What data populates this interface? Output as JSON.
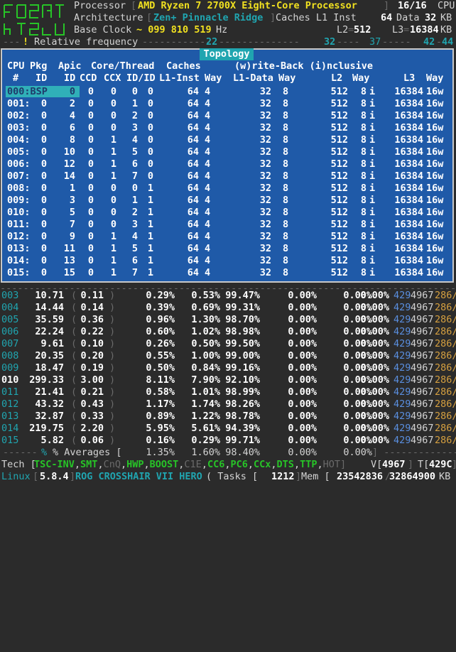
{
  "header": {
    "processor_label": "Processor",
    "processor_name": "AMD Ryzen 7 2700X Eight-Core Processor",
    "cpu_count": "16/16",
    "cpu_unit": "CPU",
    "architecture_label": "Architecture",
    "architecture_value": "Zen+ Pinnacle Ridge",
    "caches_label": "Caches L1 Inst",
    "l1_inst": "64",
    "data_label": "Data",
    "l1_data": "32",
    "kb": "KB",
    "base_clock_label": "Base Clock",
    "base_clock_value": "~ 099 810 519",
    "hz": "Hz",
    "l2_label": "L2",
    "l2_value": "512",
    "l3_label": "L3",
    "l3_value": "16384",
    "rel_freq_marker": "!",
    "rel_freq_label": "Relative frequency",
    "rel_freq_ticks": [
      "22",
      "32",
      "37",
      "42",
      "44"
    ]
  },
  "topology": {
    "title": "Topology",
    "header1": [
      "CPU",
      "Pkg",
      "Apic",
      "Core/Thread",
      "Caches",
      "(w)rite-Back (i)nclusive"
    ],
    "header2": [
      "#",
      "ID",
      "ID",
      "CCD",
      "CCX",
      "ID/ID",
      "L1-Inst",
      "Way",
      "L1-Data",
      "Way",
      "L2",
      "Way",
      "L3",
      "Way"
    ],
    "rows": [
      {
        "cpu": "000:BSP",
        "pkg": "",
        "apic": "0",
        "ccd": "0",
        "ccx": "0",
        "core": "0",
        "thread": "0",
        "l1i": "64",
        "l1iw": "4",
        "l1d": "32",
        "l1dw": "8",
        "l2": "512",
        "l2w": "8",
        "incl": "i",
        "l3": "16384",
        "l3w": "16w"
      },
      {
        "cpu": "001:",
        "pkg": "0",
        "apic": "2",
        "ccd": "0",
        "ccx": "0",
        "core": "1",
        "thread": "0",
        "l1i": "64",
        "l1iw": "4",
        "l1d": "32",
        "l1dw": "8",
        "l2": "512",
        "l2w": "8",
        "incl": "i",
        "l3": "16384",
        "l3w": "16w"
      },
      {
        "cpu": "002:",
        "pkg": "0",
        "apic": "4",
        "ccd": "0",
        "ccx": "0",
        "core": "2",
        "thread": "0",
        "l1i": "64",
        "l1iw": "4",
        "l1d": "32",
        "l1dw": "8",
        "l2": "512",
        "l2w": "8",
        "incl": "i",
        "l3": "16384",
        "l3w": "16w"
      },
      {
        "cpu": "003:",
        "pkg": "0",
        "apic": "6",
        "ccd": "0",
        "ccx": "0",
        "core": "3",
        "thread": "0",
        "l1i": "64",
        "l1iw": "4",
        "l1d": "32",
        "l1dw": "8",
        "l2": "512",
        "l2w": "8",
        "incl": "i",
        "l3": "16384",
        "l3w": "16w"
      },
      {
        "cpu": "004:",
        "pkg": "0",
        "apic": "8",
        "ccd": "0",
        "ccx": "1",
        "core": "4",
        "thread": "0",
        "l1i": "64",
        "l1iw": "4",
        "l1d": "32",
        "l1dw": "8",
        "l2": "512",
        "l2w": "8",
        "incl": "i",
        "l3": "16384",
        "l3w": "16w"
      },
      {
        "cpu": "005:",
        "pkg": "0",
        "apic": "10",
        "ccd": "0",
        "ccx": "1",
        "core": "5",
        "thread": "0",
        "l1i": "64",
        "l1iw": "4",
        "l1d": "32",
        "l1dw": "8",
        "l2": "512",
        "l2w": "8",
        "incl": "i",
        "l3": "16384",
        "l3w": "16w"
      },
      {
        "cpu": "006:",
        "pkg": "0",
        "apic": "12",
        "ccd": "0",
        "ccx": "1",
        "core": "6",
        "thread": "0",
        "l1i": "64",
        "l1iw": "4",
        "l1d": "32",
        "l1dw": "8",
        "l2": "512",
        "l2w": "8",
        "incl": "i",
        "l3": "16384",
        "l3w": "16w"
      },
      {
        "cpu": "007:",
        "pkg": "0",
        "apic": "14",
        "ccd": "0",
        "ccx": "1",
        "core": "7",
        "thread": "0",
        "l1i": "64",
        "l1iw": "4",
        "l1d": "32",
        "l1dw": "8",
        "l2": "512",
        "l2w": "8",
        "incl": "i",
        "l3": "16384",
        "l3w": "16w"
      },
      {
        "cpu": "008:",
        "pkg": "0",
        "apic": "1",
        "ccd": "0",
        "ccx": "0",
        "core": "0",
        "thread": "1",
        "l1i": "64",
        "l1iw": "4",
        "l1d": "32",
        "l1dw": "8",
        "l2": "512",
        "l2w": "8",
        "incl": "i",
        "l3": "16384",
        "l3w": "16w"
      },
      {
        "cpu": "009:",
        "pkg": "0",
        "apic": "3",
        "ccd": "0",
        "ccx": "0",
        "core": "1",
        "thread": "1",
        "l1i": "64",
        "l1iw": "4",
        "l1d": "32",
        "l1dw": "8",
        "l2": "512",
        "l2w": "8",
        "incl": "i",
        "l3": "16384",
        "l3w": "16w"
      },
      {
        "cpu": "010:",
        "pkg": "0",
        "apic": "5",
        "ccd": "0",
        "ccx": "0",
        "core": "2",
        "thread": "1",
        "l1i": "64",
        "l1iw": "4",
        "l1d": "32",
        "l1dw": "8",
        "l2": "512",
        "l2w": "8",
        "incl": "i",
        "l3": "16384",
        "l3w": "16w"
      },
      {
        "cpu": "011:",
        "pkg": "0",
        "apic": "7",
        "ccd": "0",
        "ccx": "0",
        "core": "3",
        "thread": "1",
        "l1i": "64",
        "l1iw": "4",
        "l1d": "32",
        "l1dw": "8",
        "l2": "512",
        "l2w": "8",
        "incl": "i",
        "l3": "16384",
        "l3w": "16w"
      },
      {
        "cpu": "012:",
        "pkg": "0",
        "apic": "9",
        "ccd": "0",
        "ccx": "1",
        "core": "4",
        "thread": "1",
        "l1i": "64",
        "l1iw": "4",
        "l1d": "32",
        "l1dw": "8",
        "l2": "512",
        "l2w": "8",
        "incl": "i",
        "l3": "16384",
        "l3w": "16w"
      },
      {
        "cpu": "013:",
        "pkg": "0",
        "apic": "11",
        "ccd": "0",
        "ccx": "1",
        "core": "5",
        "thread": "1",
        "l1i": "64",
        "l1iw": "4",
        "l1d": "32",
        "l1dw": "8",
        "l2": "512",
        "l2w": "8",
        "incl": "i",
        "l3": "16384",
        "l3w": "16w"
      },
      {
        "cpu": "014:",
        "pkg": "0",
        "apic": "13",
        "ccd": "0",
        "ccx": "1",
        "core": "6",
        "thread": "1",
        "l1i": "64",
        "l1iw": "4",
        "l1d": "32",
        "l1dw": "8",
        "l2": "512",
        "l2w": "8",
        "incl": "i",
        "l3": "16384",
        "l3w": "16w"
      },
      {
        "cpu": "015:",
        "pkg": "0",
        "apic": "15",
        "ccd": "0",
        "ccx": "1",
        "core": "7",
        "thread": "1",
        "l1i": "64",
        "l1iw": "4",
        "l1d": "32",
        "l1dw": "8",
        "l2": "512",
        "l2w": "8",
        "incl": "i",
        "l3": "16384",
        "l3w": "16w"
      }
    ]
  },
  "stats": {
    "rows": [
      {
        "cpu": "003",
        "freq": "10.71",
        "ratio": "0.11",
        "c0": "0.29%",
        "c1": "0.53%",
        "c3": "99.47%",
        "c6": "0.00%",
        "c7": "0.00%",
        "c8": "0.00%",
        "tail_a": "429",
        "tail_b": "4967",
        "tail_c": "286/"
      },
      {
        "cpu": "004",
        "freq": "14.44",
        "ratio": "0.14",
        "c0": "0.39%",
        "c1": "0.69%",
        "c3": "99.31%",
        "c6": "0.00%",
        "c7": "0.00%",
        "c8": "0.00%",
        "tail_a": "429",
        "tail_b": "4967",
        "tail_c": "286/"
      },
      {
        "cpu": "005",
        "freq": "35.59",
        "ratio": "0.36",
        "c0": "0.96%",
        "c1": "1.30%",
        "c3": "98.70%",
        "c6": "0.00%",
        "c7": "0.00%",
        "c8": "0.00%",
        "tail_a": "429",
        "tail_b": "4967",
        "tail_c": "286/"
      },
      {
        "cpu": "006",
        "freq": "22.24",
        "ratio": "0.22",
        "c0": "0.60%",
        "c1": "1.02%",
        "c3": "98.98%",
        "c6": "0.00%",
        "c7": "0.00%",
        "c8": "0.00%",
        "tail_a": "429",
        "tail_b": "4967",
        "tail_c": "286/"
      },
      {
        "cpu": "007",
        "freq": "9.61",
        "ratio": "0.10",
        "c0": "0.26%",
        "c1": "0.50%",
        "c3": "99.50%",
        "c6": "0.00%",
        "c7": "0.00%",
        "c8": "0.00%",
        "tail_a": "429",
        "tail_b": "4967",
        "tail_c": "286/"
      },
      {
        "cpu": "008",
        "freq": "20.35",
        "ratio": "0.20",
        "c0": "0.55%",
        "c1": "1.00%",
        "c3": "99.00%",
        "c6": "0.00%",
        "c7": "0.00%",
        "c8": "0.00%",
        "tail_a": "429",
        "tail_b": "4967",
        "tail_c": "286/"
      },
      {
        "cpu": "009",
        "freq": "18.47",
        "ratio": "0.19",
        "c0": "0.50%",
        "c1": "0.84%",
        "c3": "99.16%",
        "c6": "0.00%",
        "c7": "0.00%",
        "c8": "0.00%",
        "tail_a": "429",
        "tail_b": "4967",
        "tail_c": "286/"
      },
      {
        "cpu": "010",
        "freq": "299.33",
        "ratio": "3.00",
        "c0": "8.11%",
        "c1": "7.90%",
        "c3": "92.10%",
        "c6": "0.00%",
        "c7": "0.00%",
        "c8": "0.00%",
        "tail_a": "429",
        "tail_b": "4967",
        "tail_c": "286/"
      },
      {
        "cpu": "011",
        "freq": "21.41",
        "ratio": "0.21",
        "c0": "0.58%",
        "c1": "1.01%",
        "c3": "98.99%",
        "c6": "0.00%",
        "c7": "0.00%",
        "c8": "0.00%",
        "tail_a": "429",
        "tail_b": "4967",
        "tail_c": "286/"
      },
      {
        "cpu": "012",
        "freq": "43.32",
        "ratio": "0.43",
        "c0": "1.17%",
        "c1": "1.74%",
        "c3": "98.26%",
        "c6": "0.00%",
        "c7": "0.00%",
        "c8": "0.00%",
        "tail_a": "429",
        "tail_b": "4967",
        "tail_c": "286/"
      },
      {
        "cpu": "013",
        "freq": "32.87",
        "ratio": "0.33",
        "c0": "0.89%",
        "c1": "1.22%",
        "c3": "98.78%",
        "c6": "0.00%",
        "c7": "0.00%",
        "c8": "0.00%",
        "tail_a": "429",
        "tail_b": "4967",
        "tail_c": "286/"
      },
      {
        "cpu": "014",
        "freq": "219.75",
        "ratio": "2.20",
        "c0": "5.95%",
        "c1": "5.61%",
        "c3": "94.39%",
        "c6": "0.00%",
        "c7": "0.00%",
        "c8": "0.00%",
        "tail_a": "429",
        "tail_b": "4967",
        "tail_c": "286/"
      },
      {
        "cpu": "015",
        "freq": "5.82",
        "ratio": "0.06",
        "c0": "0.16%",
        "c1": "0.29%",
        "c3": "99.71%",
        "c6": "0.00%",
        "c7": "0.00%",
        "c8": "0.00%",
        "tail_a": "429",
        "tail_b": "4967",
        "tail_c": "286/"
      }
    ],
    "averages_label": "% Averages [",
    "avg_c0": "1.35%",
    "avg_c1": "1.60%",
    "avg_c3": "98.40%",
    "avg_c6": "0.00%",
    "avg_c7": "0.00%",
    "avg_c8": "0.00%"
  },
  "tech": {
    "label": "Tech [",
    "flags": [
      {
        "name": "TSC-INV",
        "on": true
      },
      {
        "name": "SMT",
        "on": true
      },
      {
        "name": "CnQ",
        "on": false
      },
      {
        "name": "HWP",
        "on": true
      },
      {
        "name": "BOOST",
        "on": true
      },
      {
        "name": "C1E",
        "on": false
      },
      {
        "name": "CC6",
        "on": true
      },
      {
        "name": "PC6",
        "on": true
      },
      {
        "name": "CCx",
        "on": true
      },
      {
        "name": "DTS",
        "on": true
      },
      {
        "name": "TTP",
        "on": true
      },
      {
        "name": "HOT",
        "on": false
      }
    ],
    "v_label": "V[",
    "v_value": "4967",
    "t_label": "T[",
    "t_value": "429C"
  },
  "bottom": {
    "os": "Linux",
    "kernel": "5.8.4",
    "board": "ROG CROSSHAIR VII HERO",
    "tasks_label": "( Tasks [",
    "tasks_value": "1212",
    "mem_label": "Mem [",
    "mem_used": "23542836",
    "mem_total": "32864900",
    "mem_unit": "KB"
  },
  "colors": {
    "topology_bg": "#1f5aa8",
    "accent_cyan": "#20a5b0",
    "accent_yellow": "#f0e020",
    "accent_green": "#27c427",
    "tail_blue": "#5a8fe0",
    "tail_orange": "#d6a040"
  }
}
